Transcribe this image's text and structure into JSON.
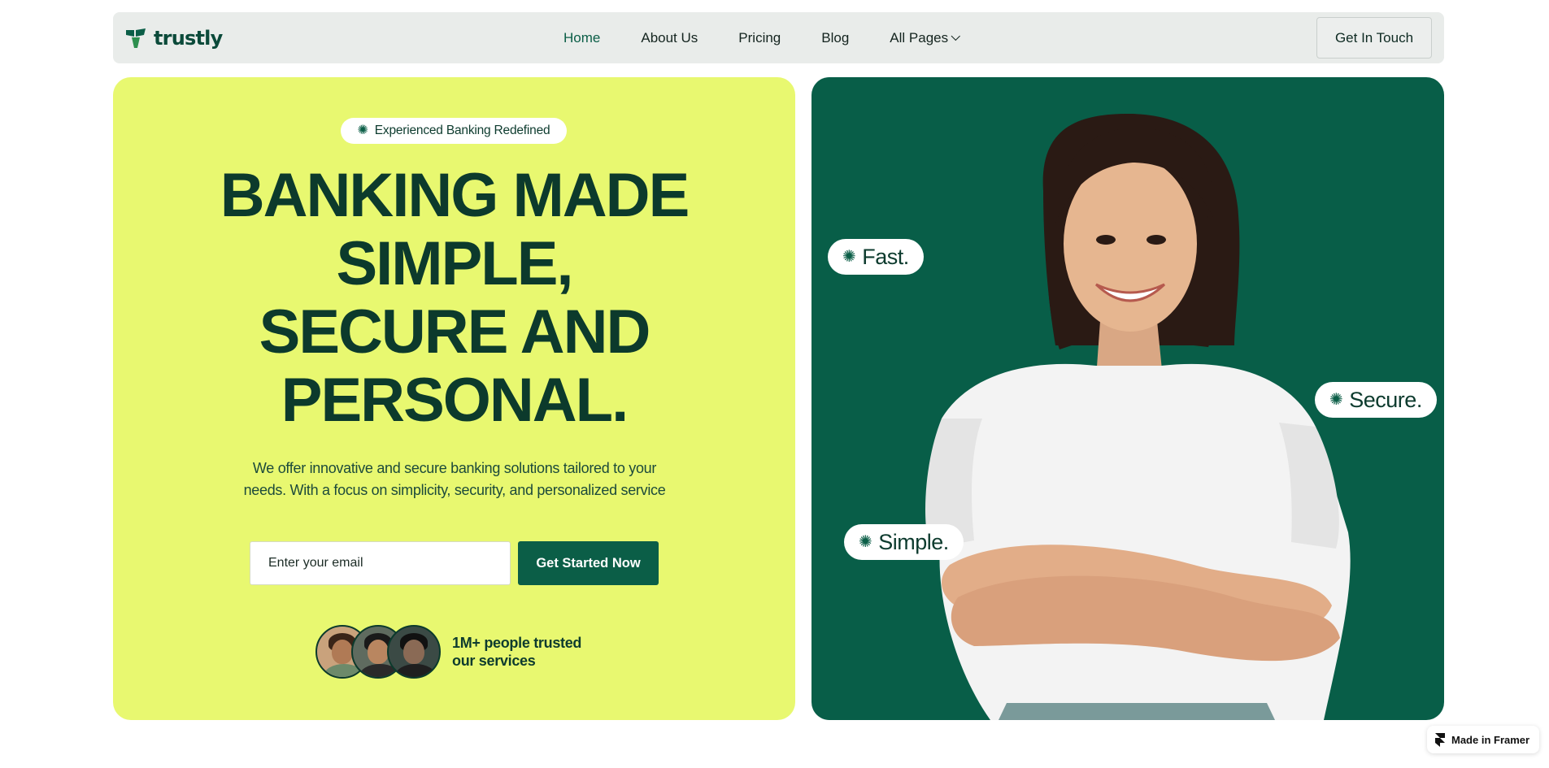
{
  "brand": {
    "name": "trustly",
    "color": "#0b5e47",
    "accent": "#e8f870"
  },
  "nav": {
    "links": [
      {
        "label": "Home",
        "active": true
      },
      {
        "label": "About Us"
      },
      {
        "label": "Pricing"
      },
      {
        "label": "Blog"
      },
      {
        "label": "All Pages",
        "dropdown": true
      }
    ],
    "cta_label": "Get In Touch"
  },
  "hero": {
    "pill_label": "Experienced Banking Redefined",
    "headline": [
      "BANKING MADE",
      "SIMPLE,",
      "SECURE AND",
      "PERSONAL."
    ],
    "subtext": "We offer innovative and secure banking solutions tailored to your needs. With a focus on simplicity, security, and personalized service",
    "email_placeholder": "Enter your email",
    "email_value": "",
    "start_label": "Get Started Now",
    "trust_text_line1": "1M+ people trusted",
    "trust_text_line2": "our services"
  },
  "tags": {
    "fast": "Fast.",
    "secure": "Secure.",
    "simple": "Simple."
  },
  "framer_badge": "Made in Framer",
  "icons": {
    "tag_icon": "asterisk-flower-icon",
    "logo": "trustly-logo-icon",
    "dropdown": "chevron-down-icon"
  }
}
